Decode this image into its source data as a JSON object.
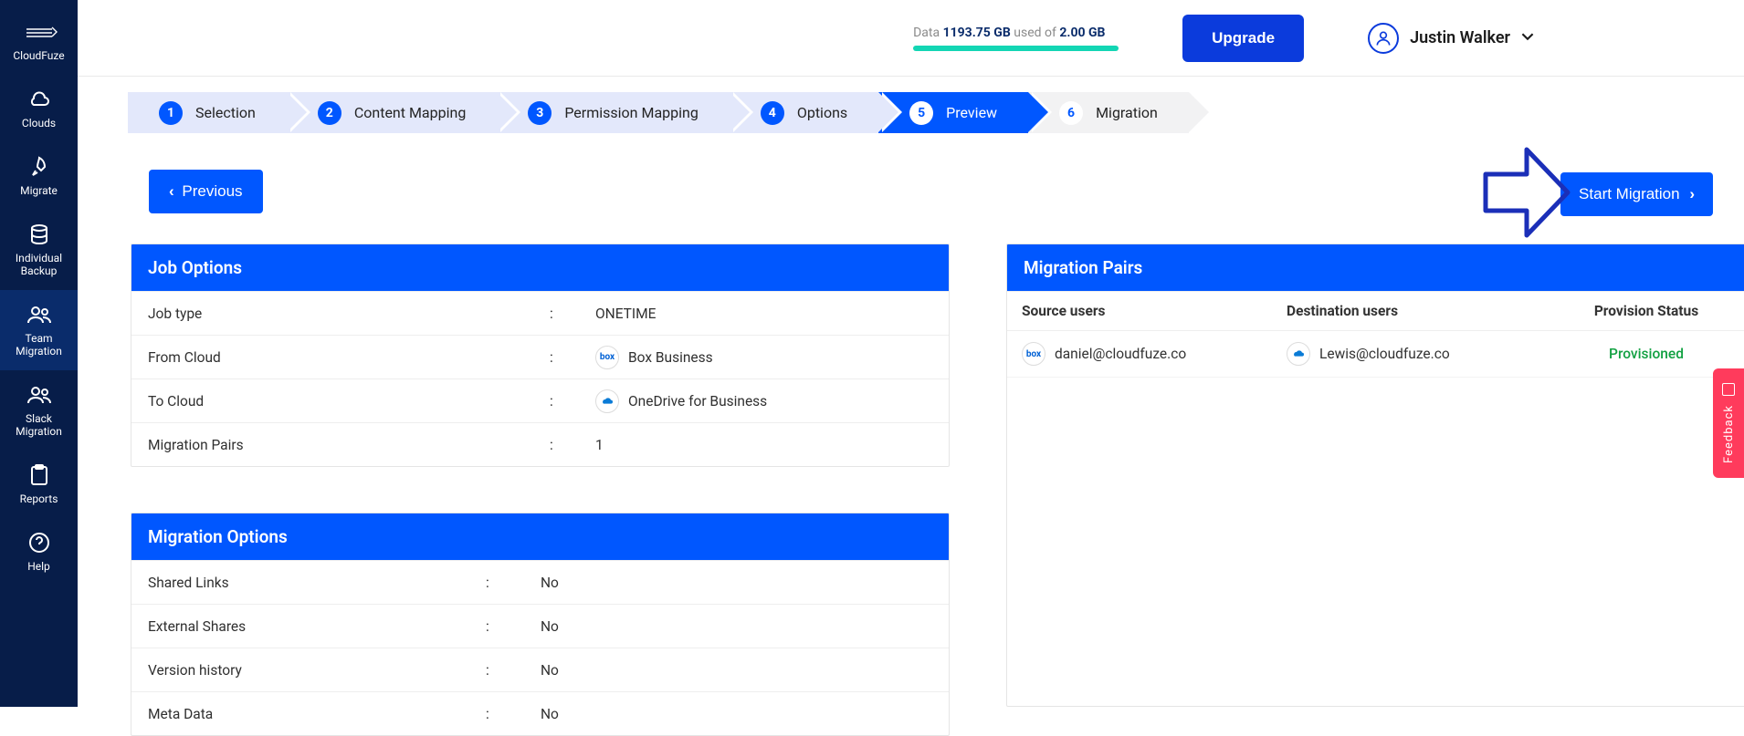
{
  "sidebar": {
    "brand_label": "CloudFuze",
    "items": [
      {
        "label": "Clouds",
        "active": false
      },
      {
        "label": "Migrate",
        "active": false
      },
      {
        "label": "Individual Backup",
        "active": false
      },
      {
        "label": "Team Migration",
        "active": true
      },
      {
        "label": "Slack Migration",
        "active": false
      },
      {
        "label": "Reports",
        "active": false
      },
      {
        "label": "Help",
        "active": false
      }
    ]
  },
  "header": {
    "usage_prefix": "Data",
    "usage_used": "1193.75 GB",
    "usage_middle": "used of",
    "usage_total": "2.00 GB",
    "upgrade_label": "Upgrade",
    "user_name": "Justin Walker"
  },
  "stepper": {
    "steps": [
      {
        "num": "1",
        "label": "Selection"
      },
      {
        "num": "2",
        "label": "Content Mapping"
      },
      {
        "num": "3",
        "label": "Permission Mapping"
      },
      {
        "num": "4",
        "label": "Options"
      },
      {
        "num": "5",
        "label": "Preview"
      },
      {
        "num": "6",
        "label": "Migration"
      }
    ],
    "active_index": 4
  },
  "buttons": {
    "previous": "Previous",
    "start_migration": "Start Migration"
  },
  "job_options": {
    "title": "Job Options",
    "rows": [
      {
        "k": "Job type",
        "v": "ONETIME"
      },
      {
        "k": "From Cloud",
        "v": "Box Business",
        "icon": "box"
      },
      {
        "k": "To Cloud",
        "v": "OneDrive for Business",
        "icon": "onedrive"
      },
      {
        "k": "Migration Pairs",
        "v": "1"
      }
    ]
  },
  "migration_options": {
    "title": "Migration Options",
    "rows": [
      {
        "k": "Shared Links",
        "v": "No"
      },
      {
        "k": "External Shares",
        "v": "No"
      },
      {
        "k": "Version history",
        "v": "No"
      },
      {
        "k": "Meta Data",
        "v": "No"
      }
    ]
  },
  "pairs": {
    "title": "Migration Pairs",
    "headers": {
      "source": "Source users",
      "dest": "Destination users",
      "status": "Provision Status"
    },
    "rows": [
      {
        "source": "daniel@cloudfuze.co",
        "source_icon": "box",
        "dest": "Lewis@cloudfuze.co",
        "dest_icon": "onedrive",
        "status": "Provisioned"
      }
    ]
  },
  "feedback_label": "Feedback"
}
